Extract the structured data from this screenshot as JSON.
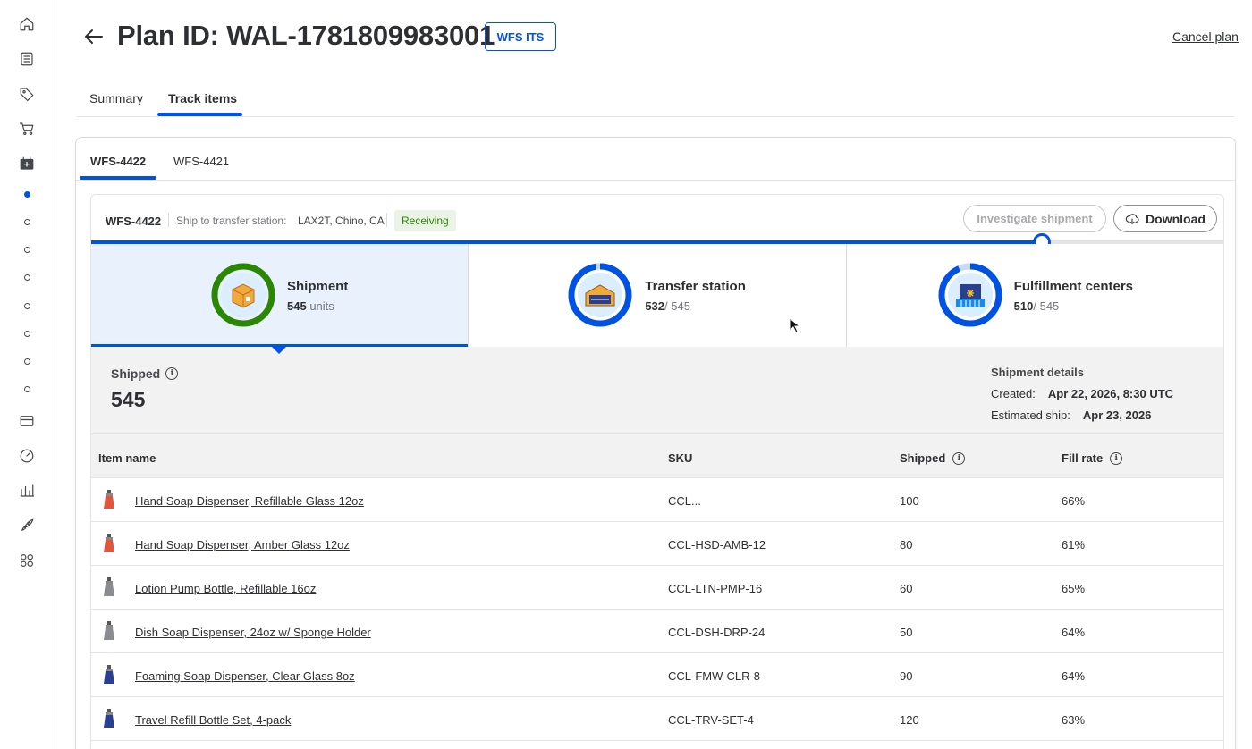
{
  "sidebar": {
    "icons": [
      "home-icon",
      "list-icon",
      "tag-icon",
      "cart-icon",
      "inventory-icon"
    ],
    "bottom_icons": [
      "payment-card-icon",
      "speedometer-icon",
      "bar-chart-icon",
      "rocket-icon",
      "apps-grid-icon"
    ]
  },
  "header": {
    "title": "Plan ID: WAL-1781809983001",
    "badge": "WFS ITS",
    "cancel_label": "Cancel plan"
  },
  "top_tabs": [
    {
      "label": "Summary",
      "active": false
    },
    {
      "label": "Track items",
      "active": true
    }
  ],
  "shipment_tabs": [
    {
      "label": "WFS-4422",
      "active": true
    },
    {
      "label": "WFS-4421",
      "active": false
    }
  ],
  "shipment": {
    "id": "WFS-4422",
    "ship_to_label": "Ship to transfer station:",
    "ship_to_value": "LAX2T, Chino, CA",
    "status": "Receiving",
    "investigate_label": "Investigate shipment",
    "download_label": "Download",
    "progress_fraction": 0.84
  },
  "stages": [
    {
      "title": "Shipment",
      "count": "545",
      "suffix": " units",
      "color": "#2a8703",
      "icon": "box-icon"
    },
    {
      "title": "Transfer station",
      "count": "532",
      "suffix": "/ 545",
      "color": "#0053e2",
      "icon": "warehouse-icon"
    },
    {
      "title": "Fulfillment centers",
      "count": "510",
      "suffix": "/ 545",
      "color": "#0053e2",
      "icon": "building-icon"
    }
  ],
  "summary": {
    "label": "Shipped",
    "value": "545",
    "details_title": "Shipment details",
    "created_label": "Created:",
    "created_value": "Apr 22, 2026, 8:30 UTC",
    "est_label": "Estimated ship:",
    "est_value": "Apr 23, 2026"
  },
  "table": {
    "columns": {
      "item": "Item name",
      "sku": "SKU",
      "shipped": "Shipped",
      "fill": "Fill rate"
    },
    "rows": [
      {
        "name": "Hand Soap Dispenser, Refillable Glass 12oz",
        "sku": "CCL...",
        "shipped": "100",
        "fill": "66%",
        "color": "#e0553d"
      },
      {
        "name": "Hand Soap Dispenser, Amber Glass 12oz",
        "sku": "CCL-HSD-AMB-12",
        "shipped": "80",
        "fill": "61%",
        "color": "#e0553d"
      },
      {
        "name": "Lotion Pump Bottle, Refillable 16oz",
        "sku": "CCL-LTN-PMP-16",
        "shipped": "60",
        "fill": "65%",
        "color": "#8a8c92"
      },
      {
        "name": "Dish Soap Dispenser, 24oz w/ Sponge Holder",
        "sku": "CCL-DSH-DRP-24",
        "shipped": "50",
        "fill": "64%",
        "color": "#8a8c92"
      },
      {
        "name": "Foaming Soap Dispenser, Clear Glass 8oz",
        "sku": "CCL-FMW-CLR-8",
        "shipped": "90",
        "fill": "64%",
        "color": "#2a3f8f"
      },
      {
        "name": "Travel Refill Bottle Set, 4-pack",
        "sku": "CCL-TRV-SET-4",
        "shipped": "120",
        "fill": "63%",
        "color": "#2a3f8f"
      }
    ]
  }
}
